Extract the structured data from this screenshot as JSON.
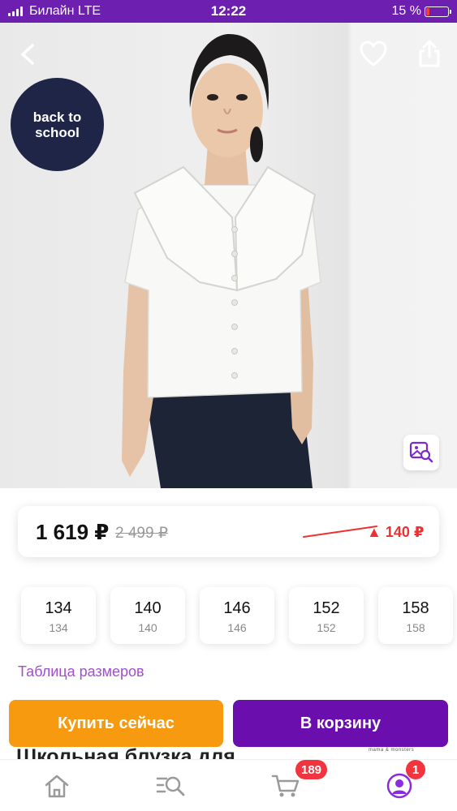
{
  "status_bar": {
    "carrier": "Билайн  LTE",
    "time": "12:22",
    "battery_percent": "15 %",
    "battery_level": 0.15
  },
  "hero": {
    "promo_badge": "back to school",
    "icons": {
      "back": "chevron-left-icon",
      "favorite": "heart-icon",
      "share": "share-icon",
      "visual_search": "image-search-icon"
    }
  },
  "price": {
    "current": "1 619 ₽",
    "old": "2 499 ₽",
    "drop": "▲ 140 ₽",
    "drop_color": "#f0302f"
  },
  "sizes": [
    {
      "main": "134",
      "sub": "134"
    },
    {
      "main": "140",
      "sub": "140"
    },
    {
      "main": "146",
      "sub": "146"
    },
    {
      "main": "152",
      "sub": "152"
    },
    {
      "main": "158",
      "sub": "158"
    }
  ],
  "size_table_link": "Таблица размеров",
  "product_title_partial": "Школьная блузка для",
  "brand_logo_text": "mama & monsters",
  "actions": {
    "buy_now": "Купить сейчас",
    "add_to_cart": "В корзину",
    "buy_color": "#f79a10",
    "cart_color": "#6a0fae"
  },
  "tab_bar": {
    "cart_badge": "189",
    "profile_badge": "1",
    "icons": [
      "home-icon",
      "catalog-search-icon",
      "cart-icon",
      "profile-icon"
    ]
  },
  "colors": {
    "brand": "#6d1fb0",
    "accent_text": "#a14fcf"
  }
}
